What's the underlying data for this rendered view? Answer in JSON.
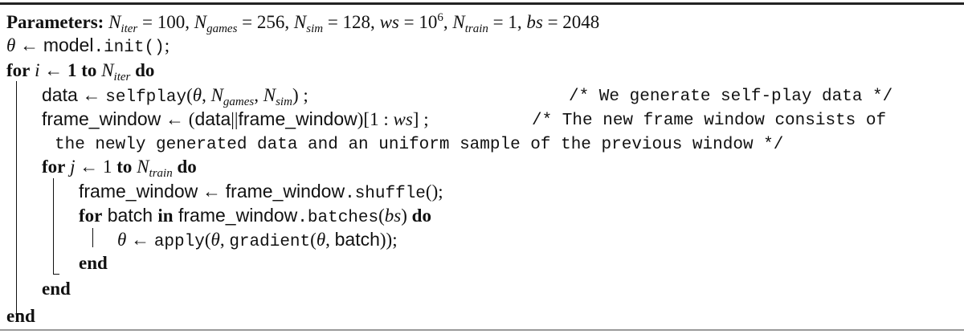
{
  "params": {
    "label": "Parameters:",
    "n_iter_var": "N",
    "n_iter_sub": "iter",
    "n_iter_val": " = 100, ",
    "n_games_var": "N",
    "n_games_sub": "games",
    "n_games_val": " = 256, ",
    "n_sim_var": "N",
    "n_sim_sub": "sim",
    "n_sim_val": " = 128, ",
    "ws_var": "ws",
    "ws_val": " = 10",
    "ws_exp": "6",
    "ws_sep": ", ",
    "n_train_var": "N",
    "n_train_sub": "train",
    "n_train_val": " = 1, ",
    "bs_var": "bs",
    "bs_val": " = 2048"
  },
  "init_line": {
    "theta": "θ",
    "arrow": " ← ",
    "model": "model",
    "dot_init": ".init()",
    "semi": ";"
  },
  "outer_for": {
    "for": "for",
    "var": " i ",
    "arrow": "← ",
    "one": "1",
    "to": " to ",
    "n": "N",
    "n_sub": "iter",
    "do": " do"
  },
  "data_line": {
    "data": "data",
    "arrow": " ← ",
    "fn": "selfplay",
    "open": "(",
    "theta": "θ",
    "comma1": ", ",
    "n_games": "N",
    "n_games_sub": "games",
    "comma2": ", ",
    "n_sim": "N",
    "n_sim_sub": "sim",
    "close": ")",
    "semi": " ;",
    "comment": "/* We generate self-play data */"
  },
  "frame_line": {
    "lhs": "frame_window",
    "arrow": " ← ",
    "open": "(",
    "data": "data",
    "concat": "||",
    "fw": "frame_window",
    "close": ")",
    "slice_open": "[1 : ",
    "ws": "ws",
    "slice_close": "]",
    "semi": " ;",
    "comment_1": "/* The new frame window consists of",
    "comment_2": "the newly generated data and an uniform sample of the previous window */"
  },
  "inner_for": {
    "for": "for",
    "var": " j ",
    "arrow": "← ",
    "one": "1",
    "to": " to ",
    "n": "N",
    "n_sub": "train",
    "do": " do"
  },
  "shuffle_line": {
    "lhs": "frame_window",
    "arrow": " ← ",
    "fw": "frame_window",
    "fn": ".shuffle",
    "call": "()",
    "semi": ";"
  },
  "batch_for": {
    "for": "for",
    "var": " batch ",
    "in": "in",
    "fw": " frame_window",
    "fn": ".batches",
    "open": "(",
    "bs": "bs",
    "close": ")",
    "do": " do"
  },
  "apply_line": {
    "theta": "θ",
    "arrow": " ← ",
    "fn": "apply",
    "open": "(",
    "theta2": "θ",
    "comma": ", ",
    "grad": "gradient",
    "open2": "(",
    "theta3": "θ",
    "comma2": ", ",
    "batch": "batch",
    "close": "));"
  },
  "ends": {
    "end_batch": "end",
    "end_inner": "end",
    "end_outer": "end"
  }
}
